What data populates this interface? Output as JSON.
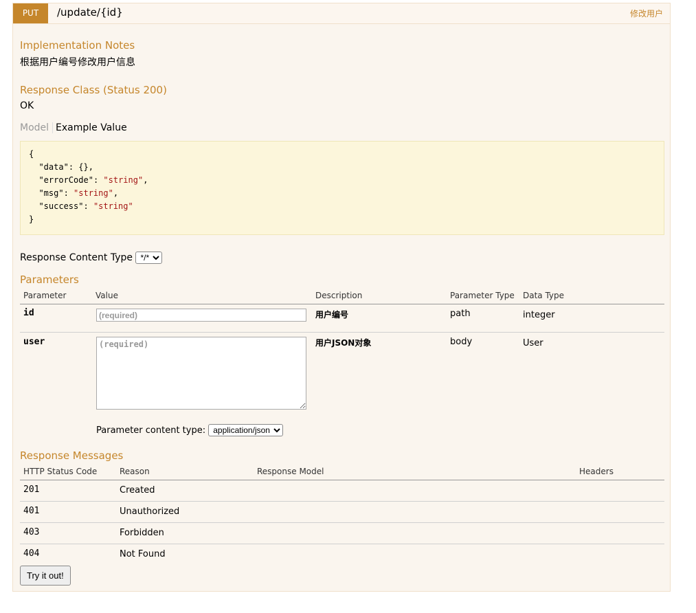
{
  "operation": {
    "method": "PUT",
    "path": "/update/{id}",
    "summary": "修改用户"
  },
  "implementation_notes": {
    "heading": "Implementation Notes",
    "text": "根据用户编号修改用户信息"
  },
  "response_class": {
    "heading": "Response Class (Status 200)",
    "text": "OK",
    "tab_model": "Model",
    "tab_example": "Example Value",
    "example": {
      "open": "{",
      "data_key": "\"data\"",
      "data_val": "{}",
      "errorCode_key": "\"errorCode\"",
      "errorCode_val": "\"string\"",
      "msg_key": "\"msg\"",
      "msg_val": "\"string\"",
      "success_key": "\"success\"",
      "success_val": "\"string\"",
      "close": "}"
    }
  },
  "response_content_type": {
    "label": "Response Content Type",
    "selected": "*/*"
  },
  "parameters": {
    "heading": "Parameters",
    "columns": [
      "Parameter",
      "Value",
      "Description",
      "Parameter Type",
      "Data Type"
    ],
    "rows": [
      {
        "name": "id",
        "placeholder": "(required)",
        "description": "用户编号",
        "param_type": "path",
        "data_type": "integer"
      },
      {
        "name": "user",
        "placeholder": "(required)",
        "description": "用户JSON对象",
        "param_type": "body",
        "data_type": "User"
      }
    ],
    "content_type_label": "Parameter content type:",
    "content_type_selected": "application/json"
  },
  "response_messages": {
    "heading": "Response Messages",
    "columns": [
      "HTTP Status Code",
      "Reason",
      "Response Model",
      "Headers"
    ],
    "rows": [
      {
        "code": "201",
        "reason": "Created"
      },
      {
        "code": "401",
        "reason": "Unauthorized"
      },
      {
        "code": "403",
        "reason": "Forbidden"
      },
      {
        "code": "404",
        "reason": "Not Found"
      }
    ]
  },
  "try_button": "Try it out!",
  "colors": {
    "method_bg": "#c5862b",
    "heading": "#c5862b",
    "panel_bg": "#faf5ee",
    "code_bg": "#fcf6db"
  }
}
